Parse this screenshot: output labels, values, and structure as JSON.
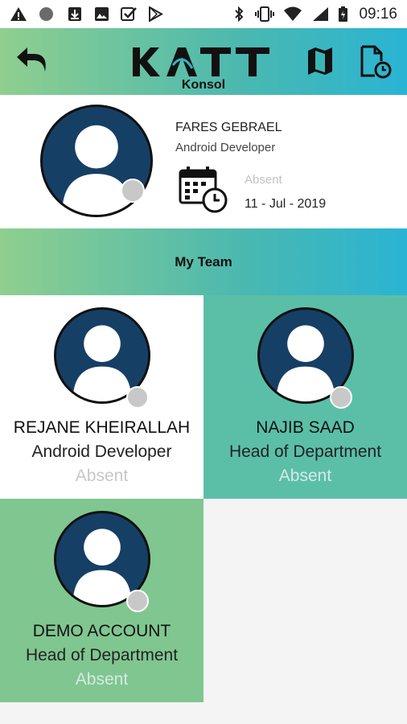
{
  "status_bar": {
    "time": "09:16"
  },
  "header": {
    "logo_text": "KATT",
    "subtitle": "Konsol"
  },
  "profile": {
    "name": "FARES GEBRAEL",
    "role": "Android Developer",
    "status": "Absent",
    "date": "11 - Jul - 2019"
  },
  "team": {
    "title": "My Team",
    "members": [
      {
        "name": "REJANE KHEIRALLAH",
        "role": "Android Developer",
        "status": "Absent"
      },
      {
        "name": "NAJIB SAAD",
        "role": "Head of Department",
        "status": "Absent"
      },
      {
        "name": "DEMO ACCOUNT",
        "role": "Head of Department",
        "status": "Absent"
      }
    ]
  },
  "colors": {
    "gradient_start": "#8fcf8f",
    "gradient_end": "#29b4d4",
    "tile_teal": "#5bbfa8",
    "tile_green": "#80c690",
    "avatar_bg": "#163f66"
  },
  "icons": [
    "warning-icon",
    "circle-icon",
    "download-icon",
    "image-icon",
    "check-icon",
    "play-store-icon",
    "bluetooth-icon",
    "vibrate-icon",
    "wifi-icon",
    "signal-icon",
    "battery-icon",
    "back-icon",
    "map-icon",
    "history-icon",
    "calendar-clock-icon",
    "avatar-icon"
  ]
}
